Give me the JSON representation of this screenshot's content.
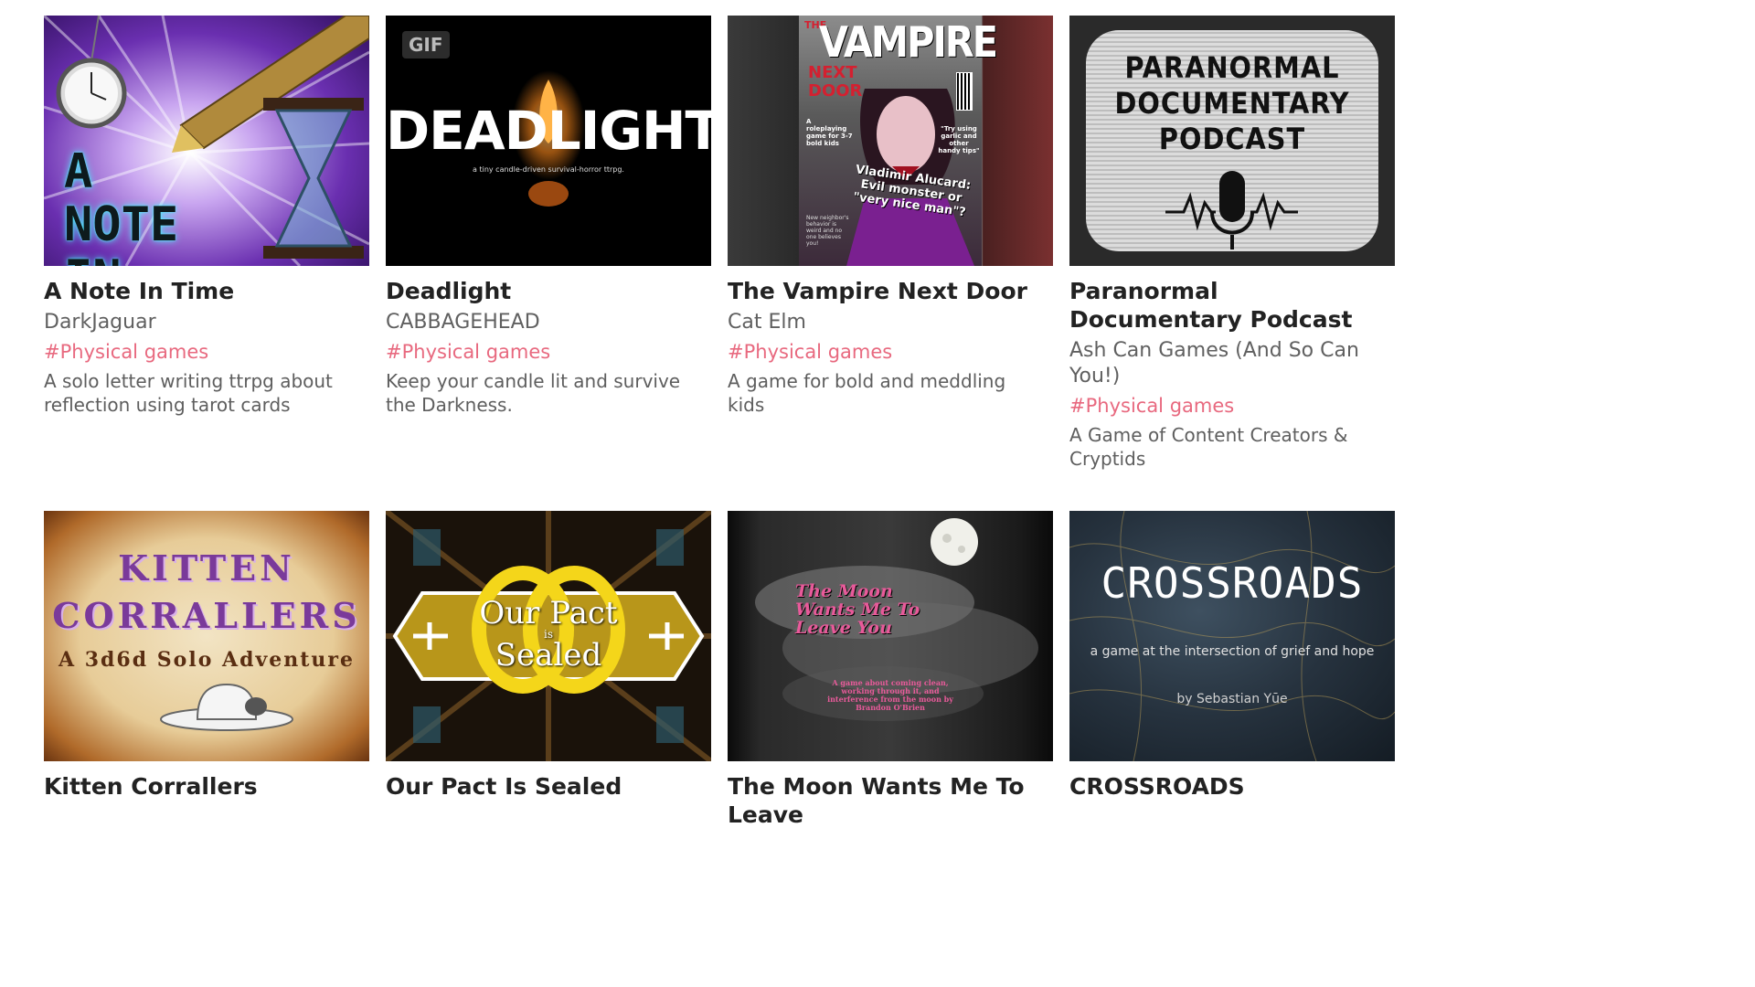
{
  "row1": [
    {
      "title": "A Note In Time",
      "author": "DarkJaguar",
      "tag": "#Physical games",
      "description": "A solo letter writing ttrpg about reflection using tarot cards",
      "cover": {
        "line1": "A NOTE",
        "line2": "IN TIME"
      }
    },
    {
      "title": "Deadlight",
      "author": "CABBAGEHEAD",
      "tag": "#Physical games",
      "description": "Keep your candle lit and survive the Darkness.",
      "badge": "GIF",
      "cover": {
        "main": "DEADLIGHT",
        "sub": "a tiny candle-driven survival-horror ttrpg."
      }
    },
    {
      "title": "The Vampire Next Door",
      "author": "Cat Elm",
      "tag": "#Physical games",
      "description": "A game for bold and meddling kids",
      "cover": {
        "the": "THE",
        "main": "VAMPIRE",
        "next": "NEXT",
        "door": "DOOR",
        "blurb": "A roleplaying game for 3-7 bold kids",
        "quote": "\"Try using garlic and other handy tips\"",
        "headline": "Vladimir Alucard: Evil monster or \"very nice man\"?",
        "side": "New neighbor's behavior is weird and no one believes you!"
      }
    },
    {
      "title": "Paranormal Documentary Podcast",
      "author": "Ash Can Games (And So Can You!)",
      "tag": "#Physical games",
      "description": "A Game of Content Creators & Cryptids",
      "cover": {
        "line1": "PARANORMAL",
        "line2": "DOCUMENTARY",
        "line3": "PODCAST"
      }
    }
  ],
  "row2": [
    {
      "title": "Kitten Corrallers",
      "cover": {
        "line1": "KITTEN",
        "line2": "CORRALLERS",
        "line3": "A 3d6d Solo Adventure"
      }
    },
    {
      "title": "Our Pact Is Sealed",
      "cover": {
        "line1": "Our Pact",
        "line2": "is",
        "line3": "Sealed"
      }
    },
    {
      "title": "The Moon Wants Me To Leave",
      "cover": {
        "main": "The Moon Wants Me To Leave You",
        "sub": "A game about coming clean, working through it, and interference from the moon by Brandon O'Brien"
      }
    },
    {
      "title": "CROSSROADS",
      "cover": {
        "main": "CROSSROADS",
        "tagline": "a game at the intersection of grief and hope",
        "byline": "by Sebastian Yūe"
      }
    }
  ],
  "colors": {
    "tag": "#e8697f",
    "title": "#222222",
    "author": "#606060",
    "description": "#5e5e5e"
  },
  "icons": [
    "pocket-watch-icon",
    "fountain-pen-icon",
    "hourglass-icon",
    "candle-icon",
    "microphone-icon",
    "cowboy-hat-icon",
    "moon-icon"
  ]
}
